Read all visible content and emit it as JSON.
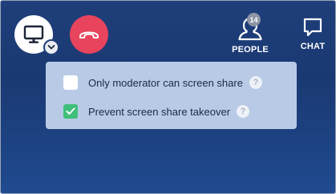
{
  "controls": {
    "share_icon": "monitor-icon",
    "hangup_icon": "phone-hangup-icon"
  },
  "top_right": {
    "people": {
      "label": "PEOPLE",
      "count": "14",
      "icon": "person-icon"
    },
    "chat": {
      "label": "CHAT",
      "icon": "chat-bubble-icon"
    }
  },
  "share_menu": {
    "options": [
      {
        "label": "Only moderator can screen share",
        "checked": false,
        "help_icon": "?"
      },
      {
        "label": "Prevent screen share takeover",
        "checked": true,
        "help_icon": "?"
      }
    ]
  },
  "colors": {
    "background": "#1f3f7a",
    "hangup": "#e8445d",
    "checkbox_checked": "#3fbf7a",
    "menu_bg": "#bfcee8"
  }
}
